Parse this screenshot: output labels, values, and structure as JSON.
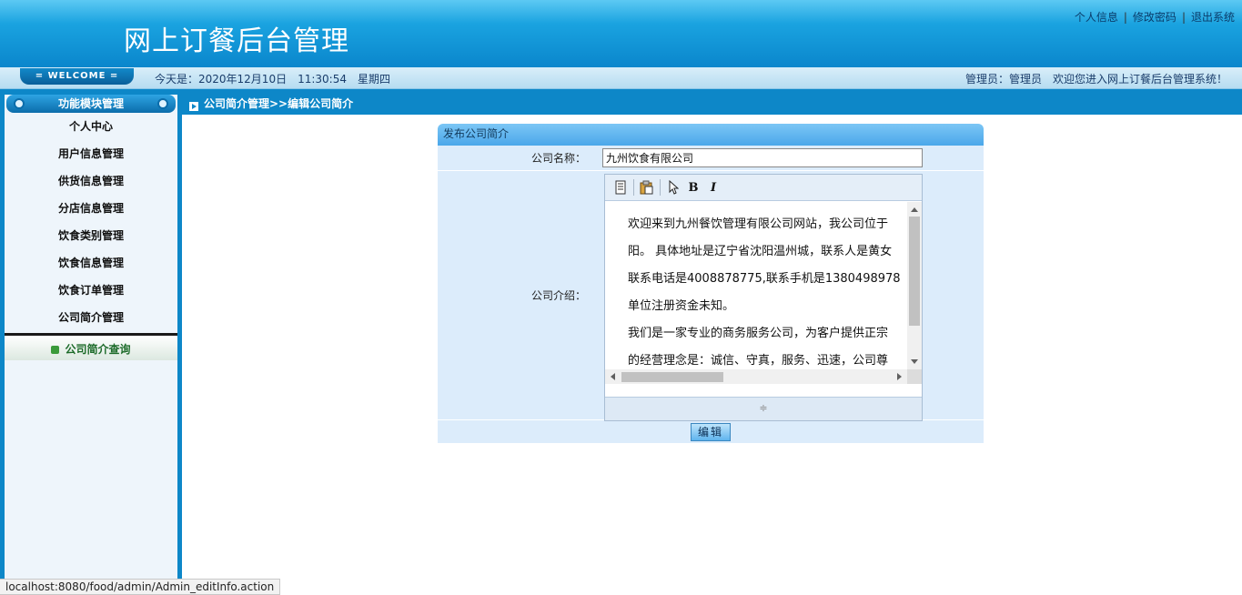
{
  "header": {
    "title": "网上订餐后台管理",
    "links": [
      "个人信息",
      "修改密码",
      "退出系统"
    ]
  },
  "infobar": {
    "welcome": "= WELCOME =",
    "date": "今天是：2020年12月10日　11:30:54　星期四",
    "admin": "管理员：管理员　欢迎您进入网上订餐后台管理系统！"
  },
  "sidebar": {
    "header": "功能模块管理",
    "items": [
      "个人中心",
      "用户信息管理",
      "供货信息管理",
      "分店信息管理",
      "饮食类别管理",
      "饮食信息管理",
      "饮食订单管理",
      "公司简介管理"
    ],
    "sub": "公司简介查询"
  },
  "breadcrumb": "公司简介管理>>编辑公司简介",
  "form": {
    "title": "发布公司简介",
    "name_label": "公司名称：",
    "name_value": "九州饮食有限公司",
    "intro_label": "公司介绍：",
    "intro_lines": [
      "欢迎来到九州餐饮管理有限公司网站，我公司位于",
      "阳。 具体地址是辽宁省沈阳温州城，联系人是黄女",
      "联系电话是4008878775,联系手机是1380498978",
      "单位注册资金未知。",
      "我们是一家专业的商务服务公司，为客户提供正宗",
      "的经营理念是：诚信、守真，服务、迅速，公司尊"
    ],
    "toolbar": {
      "bold": "B",
      "italic": "I"
    },
    "resize_glyph": "≑",
    "button": "编辑"
  },
  "status_url": "localhost:8080/food/admin/Admin_editInfo.action"
}
